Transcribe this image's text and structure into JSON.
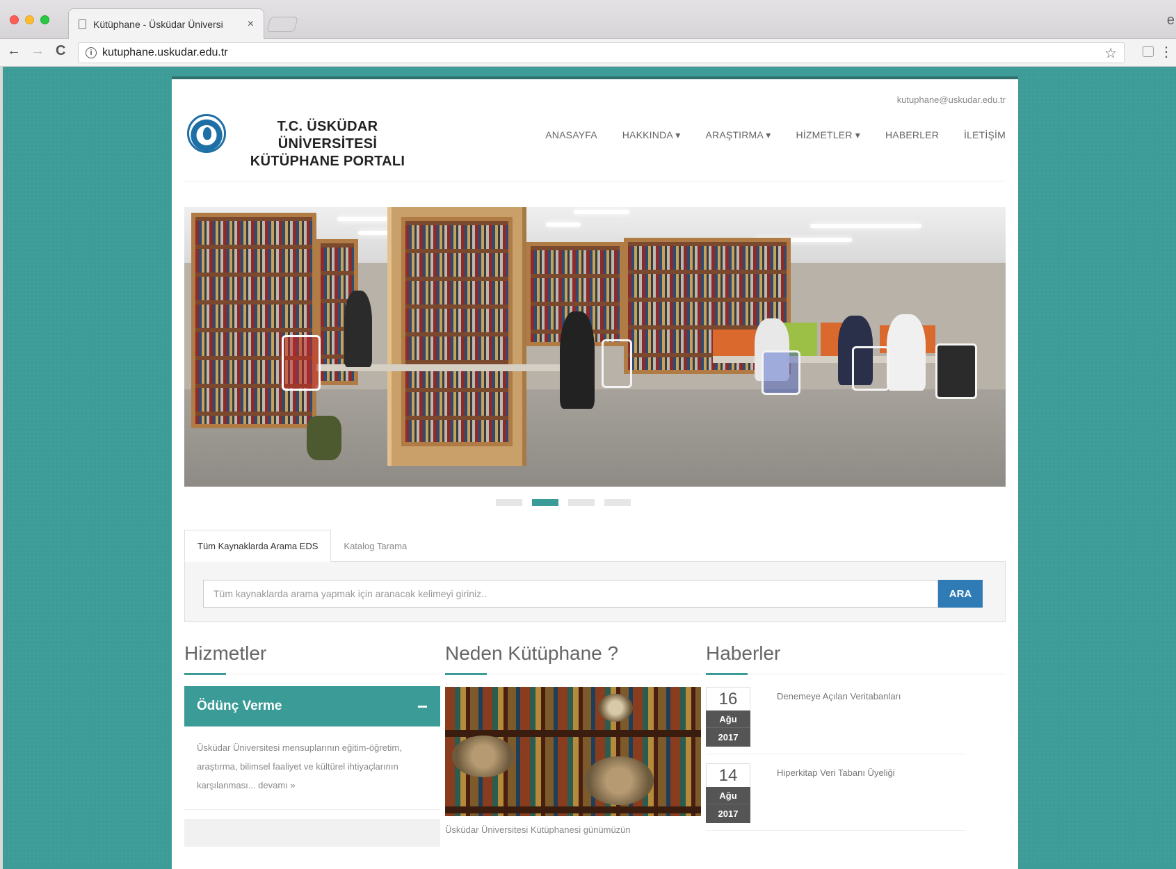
{
  "browser": {
    "tab_title": "Kütüphane - Üsküdar Üniversi",
    "tab_close": "×",
    "url": "kutuphane.uskudar.edu.tr",
    "back_glyph": "←",
    "forward_glyph": "→",
    "reload_glyph": "C",
    "info_glyph": "i",
    "star_glyph": "☆",
    "menu_glyph": "⋮",
    "profile_glyph": "e"
  },
  "header": {
    "email": "kutuphane@uskudar.edu.tr",
    "title_line1": "T.C. ÜSKÜDAR ÜNİVERSİTESİ",
    "title_line2": "KÜTÜPHANE PORTALI",
    "nav": [
      {
        "label": "ANASAYFA"
      },
      {
        "label": "HAKKINDA ▾"
      },
      {
        "label": "ARAŞTIRMA ▾"
      },
      {
        "label": "HİZMETLER ▾"
      },
      {
        "label": "HABERLER"
      },
      {
        "label": "İLETİŞİM"
      }
    ]
  },
  "slider": {
    "slide_count": 4,
    "active_index": 1
  },
  "search": {
    "tabs": [
      {
        "label": "Tüm Kaynaklarda Arama EDS",
        "active": true
      },
      {
        "label": "Katalog Tarama",
        "active": false
      }
    ],
    "placeholder": "Tüm kaynaklarda arama yapmak için aranacak kelimeyi giriniz..",
    "button_label": "ARA"
  },
  "services": {
    "title": "Hizmetler",
    "accordion": {
      "label": "Ödünç Verme",
      "toggle": "−",
      "body": "Üsküdar Üniversitesi mensuplarının eğitim-öğretim, araştırma, bilimsel faaliyet ve kültürel ihtiyaçlarının karşılanması... devamı »"
    }
  },
  "why": {
    "title": "Neden Kütüphane ?",
    "caption": "Üsküdar Üniversitesi Kütüphanesi günümüzün"
  },
  "news": {
    "title": "Haberler",
    "items": [
      {
        "day": "16",
        "month": "Ağu",
        "year": "2017",
        "title": "Denemeye Açılan Veritabanları"
      },
      {
        "day": "14",
        "month": "Ağu",
        "year": "2017",
        "title": "Hiperkitap Veri Tabanı Üyeliği"
      }
    ]
  },
  "colors": {
    "accent": "#3a9b97",
    "button": "#2f7bb5",
    "background": "#3e9c98"
  }
}
